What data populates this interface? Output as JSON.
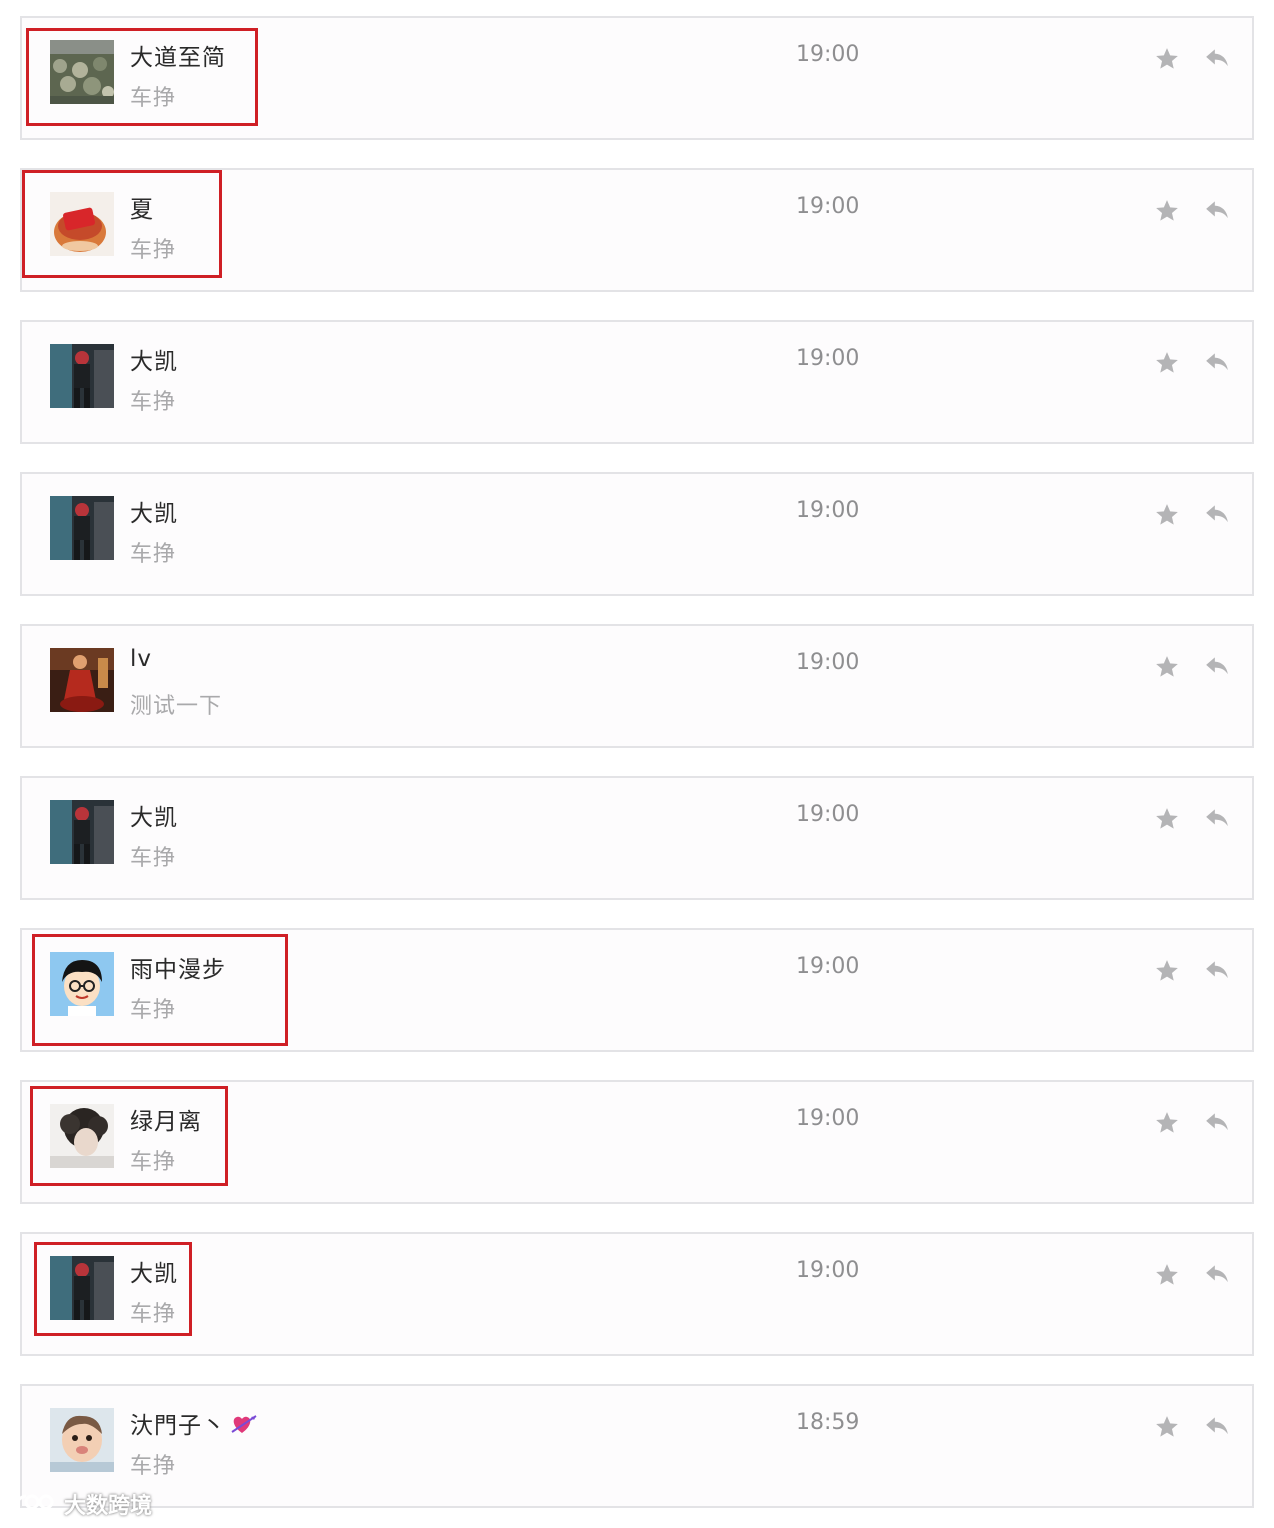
{
  "messages": [
    {
      "name": "大道至简",
      "preview": "车挣",
      "time": "19:00",
      "avatar": "avatar-landscape",
      "highlighted": true
    },
    {
      "name": "夏",
      "preview": "车挣",
      "time": "19:00",
      "avatar": "avatar-red-cup",
      "highlighted": true
    },
    {
      "name": "大凯",
      "preview": "车挣",
      "time": "19:00",
      "avatar": "avatar-person-dark",
      "highlighted": false
    },
    {
      "name": "大凯",
      "preview": "车挣",
      "time": "19:00",
      "avatar": "avatar-person-dark",
      "highlighted": false
    },
    {
      "name": "lv",
      "preview": "测试一下",
      "time": "19:00",
      "avatar": "avatar-red-figure",
      "highlighted": false
    },
    {
      "name": "大凯",
      "preview": "车挣",
      "time": "19:00",
      "avatar": "avatar-person-dark",
      "highlighted": false
    },
    {
      "name": "雨中漫步",
      "preview": "车挣",
      "time": "19:00",
      "avatar": "avatar-cartoon-boy",
      "highlighted": true
    },
    {
      "name": "绿月离",
      "preview": "车挣",
      "time": "19:00",
      "avatar": "avatar-curly-hair",
      "highlighted": true
    },
    {
      "name": "大凯",
      "preview": "车挣",
      "time": "19:00",
      "avatar": "avatar-person-dark",
      "highlighted": true
    },
    {
      "name": "汏門子丶",
      "preview": "车挣",
      "time": "18:59",
      "avatar": "avatar-baby",
      "highlighted": false,
      "name_emoji": "heart-arrow-icon"
    }
  ],
  "icons": {
    "star": "star-icon",
    "reply": "reply-icon"
  },
  "colors": {
    "highlight_border": "#cf1f25",
    "icon_gray": "#b4b4b6",
    "row_border": "#e3e3e6"
  },
  "watermark": {
    "text": "大数跨境"
  }
}
